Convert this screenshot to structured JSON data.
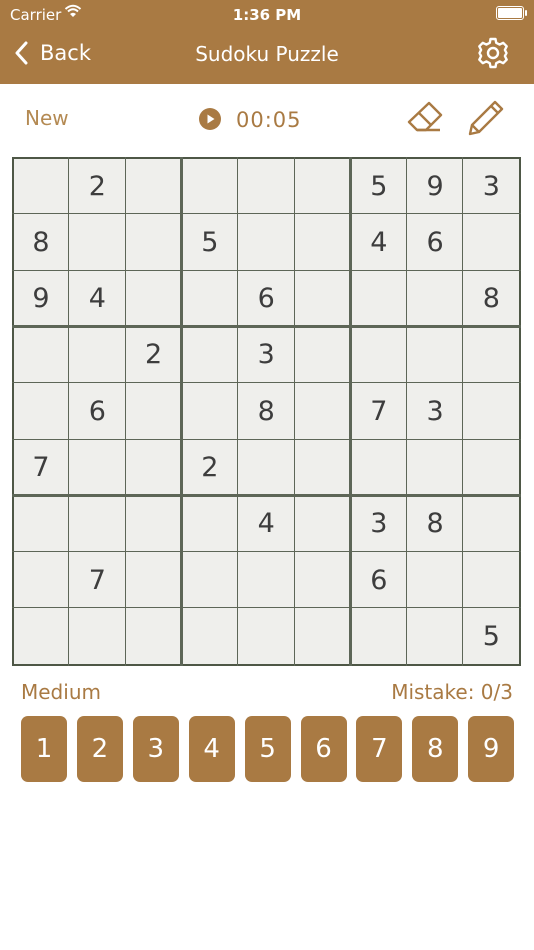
{
  "status_bar": {
    "carrier": "Carrier",
    "time": "1:36 PM"
  },
  "header": {
    "back_label": "Back",
    "title": "Sudoku Puzzle"
  },
  "toolbar": {
    "new_label": "New",
    "timer": "00:05"
  },
  "board": {
    "grid": [
      [
        "",
        "2",
        "",
        "",
        "",
        "",
        "5",
        "9",
        "3"
      ],
      [
        "8",
        "",
        "",
        "5",
        "",
        "",
        "4",
        "6",
        ""
      ],
      [
        "9",
        "4",
        "",
        "",
        "6",
        "",
        "",
        "",
        "8"
      ],
      [
        "",
        "",
        "2",
        "",
        "3",
        "",
        "",
        "",
        ""
      ],
      [
        "",
        "6",
        "",
        "",
        "8",
        "",
        "7",
        "3",
        ""
      ],
      [
        "7",
        "",
        "",
        "2",
        "",
        "",
        "",
        "",
        ""
      ],
      [
        "",
        "",
        "",
        "",
        "4",
        "",
        "3",
        "8",
        ""
      ],
      [
        "",
        "7",
        "",
        "",
        "",
        "",
        "6",
        "",
        ""
      ],
      [
        "",
        "",
        "",
        "",
        "",
        "",
        "",
        "",
        "5"
      ]
    ]
  },
  "footer": {
    "difficulty": "Medium",
    "mistakes": "Mistake: 0/3"
  },
  "numpad": [
    "1",
    "2",
    "3",
    "4",
    "5",
    "6",
    "7",
    "8",
    "9"
  ],
  "colors": {
    "accent": "#a97a43",
    "board_bg": "#efefec",
    "grid_line": "#4e5746"
  }
}
